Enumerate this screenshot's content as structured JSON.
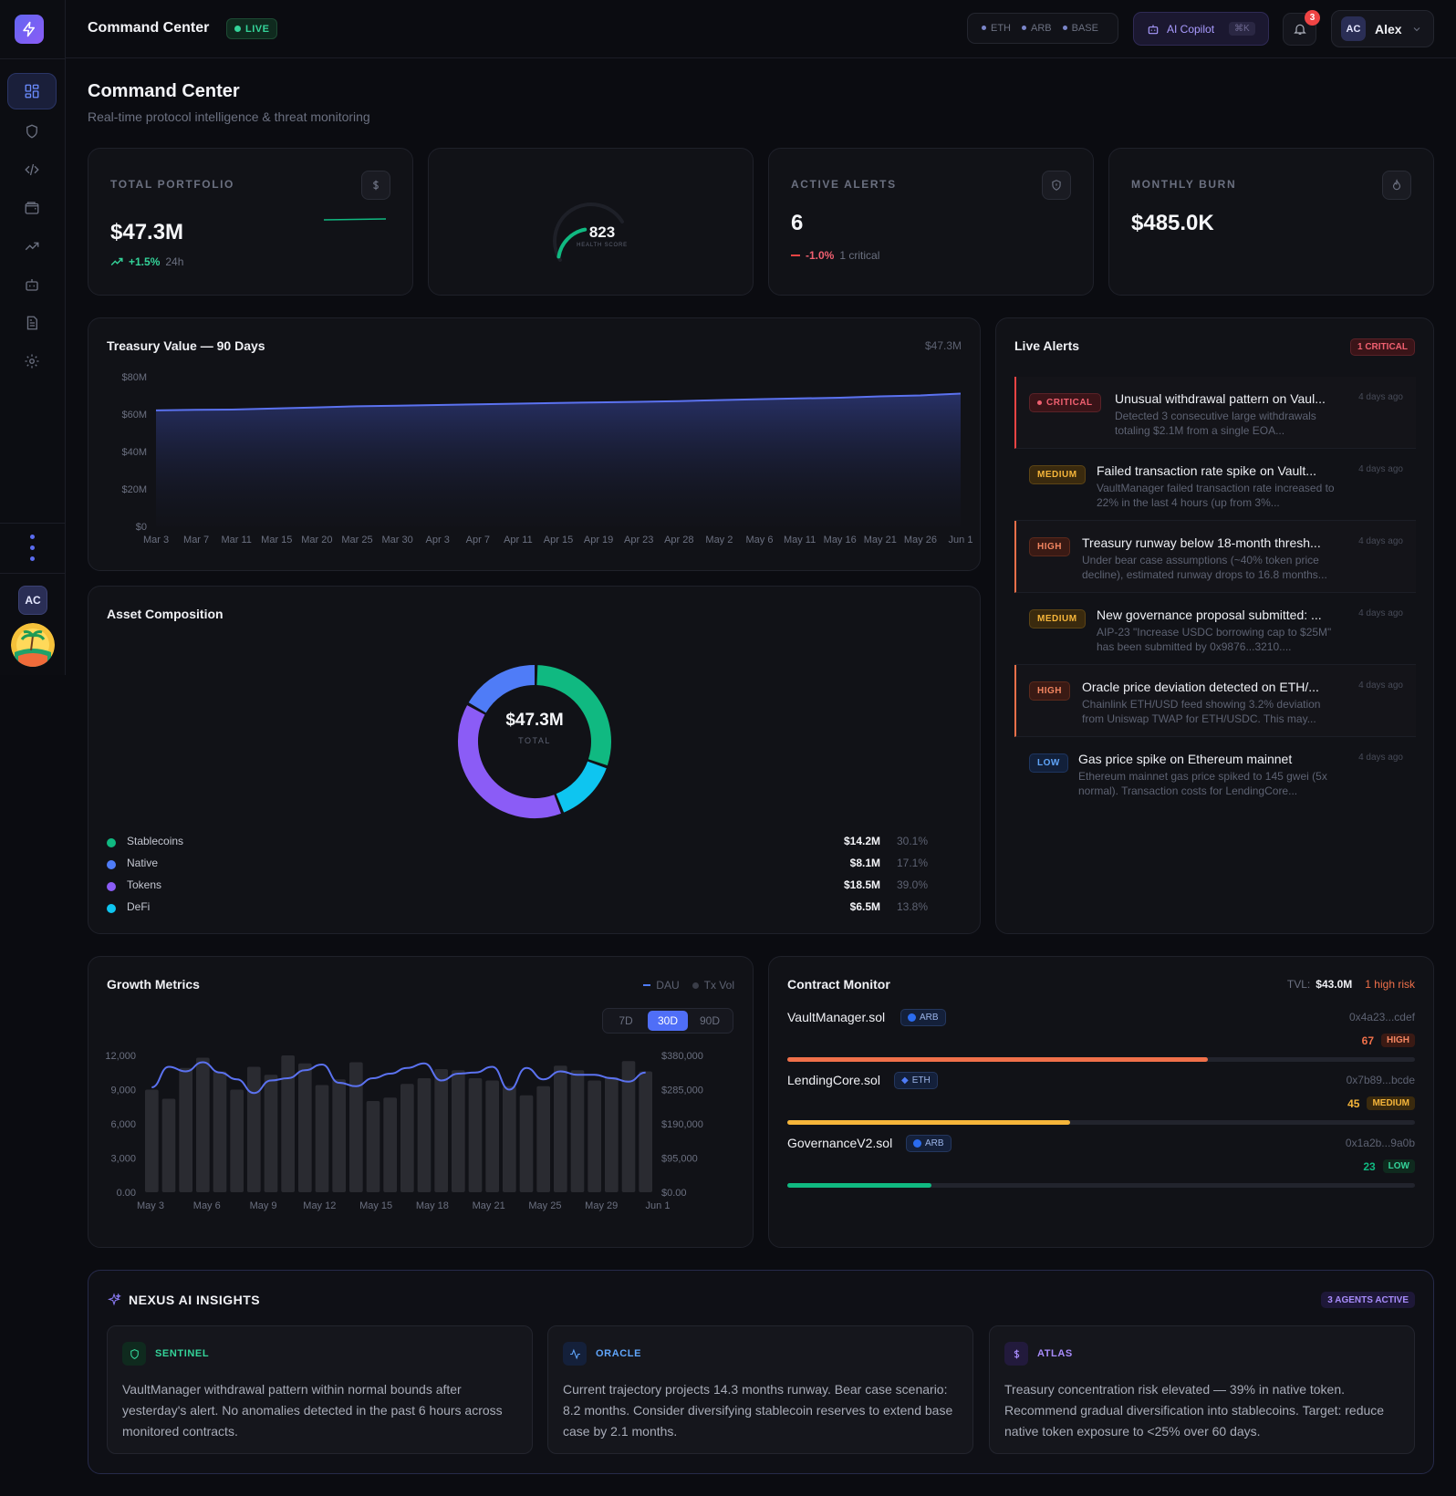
{
  "topbar": {
    "title": "Command Center",
    "live": "LIVE",
    "chains": [
      "ETH",
      "ARB",
      "BASE"
    ],
    "copilot": "AI Copilot",
    "shortcut": "⌘K",
    "notifications": "3",
    "user_initials": "AC",
    "user_name": "Alex"
  },
  "sidebar": {
    "items": [
      "dashboard",
      "security",
      "code",
      "wallet",
      "analytics",
      "agents",
      "reports",
      "settings"
    ],
    "avatar": "AC"
  },
  "page": {
    "title": "Command Center",
    "subtitle": "Real-time protocol intelligence & threat monitoring"
  },
  "kpis": {
    "portfolio": {
      "label": "TOTAL PORTFOLIO",
      "value": "$47.3M",
      "change": "+1.5%",
      "period": "24h"
    },
    "health": {
      "value": "823",
      "label": "HEALTH SCORE",
      "fraction": 0.41
    },
    "alerts": {
      "label": "ACTIVE ALERTS",
      "value": "6",
      "change": "-1.0%",
      "note": "1 critical"
    },
    "burn": {
      "label": "MONTHLY BURN",
      "value": "$485.0K"
    }
  },
  "treasury": {
    "title": "Treasury Value — 90 Days",
    "current": "$47.3M"
  },
  "composition": {
    "title": "Asset Composition",
    "total": "$47.3M",
    "total_label": "TOTAL",
    "items": [
      {
        "name": "Stablecoins",
        "value": "$14.2M",
        "pct": "30.1%",
        "color": "#10b981"
      },
      {
        "name": "Native",
        "value": "$8.1M",
        "pct": "17.1%",
        "color": "#4f7cf7"
      },
      {
        "name": "Tokens",
        "value": "$18.5M",
        "pct": "39.0%",
        "color": "#8b5cf6"
      },
      {
        "name": "DeFi",
        "value": "$6.5M",
        "pct": "13.8%",
        "color": "#0ec5f0"
      }
    ]
  },
  "alerts": {
    "title": "Live Alerts",
    "badge": "1 CRITICAL",
    "items": [
      {
        "severity": "CRITICAL",
        "title": "Unusual withdrawal pattern on Vaul...",
        "desc": "Detected 3 consecutive large withdrawals totaling $2.1M from a single EOA...",
        "time": "4 days ago"
      },
      {
        "severity": "MEDIUM",
        "title": "Failed transaction rate spike on Vault...",
        "desc": "VaultManager failed transaction rate increased to 22% in the last 4 hours (up from 3%...",
        "time": "4 days ago"
      },
      {
        "severity": "HIGH",
        "title": "Treasury runway below 18-month thresh...",
        "desc": "Under bear case assumptions (~40% token price decline), estimated runway drops to 16.8 months...",
        "time": "4 days ago"
      },
      {
        "severity": "MEDIUM",
        "title": "New governance proposal submitted: ...",
        "desc": "AIP-23 \"Increase USDC borrowing cap to $25M\" has been submitted by 0x9876...3210....",
        "time": "4 days ago"
      },
      {
        "severity": "HIGH",
        "title": "Oracle price deviation detected on ETH/...",
        "desc": "Chainlink ETH/USD feed showing 3.2% deviation from Uniswap TWAP for ETH/USDC. This may...",
        "time": "4 days ago"
      },
      {
        "severity": "LOW",
        "title": "Gas price spike on Ethereum mainnet",
        "desc": "Ethereum mainnet gas price spiked to 145 gwei (5x normal). Transaction costs for LendingCore...",
        "time": "4 days ago"
      }
    ]
  },
  "growth": {
    "title": "Growth Metrics",
    "legend": [
      "DAU",
      "Tx Vol"
    ],
    "ranges": [
      "7D",
      "30D",
      "90D"
    ],
    "selected": "30D"
  },
  "contracts": {
    "title": "Contract Monitor",
    "tvl_label": "TVL:",
    "tvl": "$43.0M",
    "risk_note": "1 high risk",
    "items": [
      {
        "name": "VaultManager.sol",
        "chain": "ARB",
        "address": "0x4a23...cdef",
        "score": "67",
        "level": "HIGH",
        "fraction": 0.67,
        "color": "#f0704a"
      },
      {
        "name": "LendingCore.sol",
        "chain": "ETH",
        "address": "0x7b89...bcde",
        "score": "45",
        "level": "MEDIUM",
        "fraction": 0.45,
        "color": "#f5b53a"
      },
      {
        "name": "GovernanceV2.sol",
        "chain": "ARB",
        "address": "0x1a2b...9a0b",
        "score": "23",
        "level": "LOW",
        "fraction": 0.23,
        "color": "#10b981"
      }
    ]
  },
  "insights": {
    "title": "NEXUS AI INSIGHTS",
    "badge": "3 AGENTS ACTIVE",
    "cards": [
      {
        "agent": "SENTINEL",
        "text": "VaultManager withdrawal pattern within normal bounds after yesterday's alert. No anomalies detected in the past 6 hours across monitored contracts.",
        "color": "#34d399"
      },
      {
        "agent": "ORACLE",
        "text": "Current trajectory projects 14.3 months runway. Bear case scenario: 8.2 months. Consider diversifying stablecoin reserves to extend base case by 2.1 months.",
        "color": "#60a5fa"
      },
      {
        "agent": "ATLAS",
        "text": "Treasury concentration risk elevated — 39% in native token. Recommend gradual diversification into stablecoins. Target: reduce native token exposure to <25% over 60 days.",
        "color": "#a78bfa"
      }
    ]
  },
  "chart_data": [
    {
      "type": "area",
      "title": "Treasury Value — 90 Days",
      "x": [
        "Mar 3",
        "Mar 7",
        "Mar 11",
        "Mar 15",
        "Mar 20",
        "Mar 25",
        "Mar 30",
        "Apr 3",
        "Apr 7",
        "Apr 11",
        "Apr 15",
        "Apr 19",
        "Apr 23",
        "Apr 28",
        "May 2",
        "May 6",
        "May 11",
        "May 16",
        "May 21",
        "May 26",
        "Jun 1"
      ],
      "y_ticks": [
        "$0",
        "$20M",
        "$40M",
        "$60M",
        "$80M"
      ],
      "ylim": [
        0,
        80
      ],
      "series": [
        {
          "values": [
            62,
            62.3,
            62.5,
            63,
            63.6,
            64.2,
            64.5,
            64.9,
            65.2,
            65.6,
            66,
            66.3,
            66.6,
            67,
            67.5,
            68,
            68.4,
            68.8,
            69.5,
            70,
            71
          ]
        }
      ]
    },
    {
      "type": "pie",
      "title": "Asset Composition",
      "categories": [
        "Stablecoins",
        "Native",
        "Tokens",
        "DeFi"
      ],
      "values": [
        14.2,
        8.1,
        18.5,
        6.5
      ]
    },
    {
      "type": "bar",
      "title": "Growth Metrics",
      "x": [
        "May 3",
        "May 6",
        "May 9",
        "May 12",
        "May 15",
        "May 18",
        "May 21",
        "May 25",
        "May 29",
        "Jun 1"
      ],
      "y_ticks": [
        "0.00",
        "3,000",
        "6,000",
        "9,000",
        "12,000"
      ],
      "y2_ticks": [
        "$0.00",
        "$95,000",
        "$190,000",
        "$285,000",
        "$380,000"
      ],
      "ylim": [
        0,
        12000
      ],
      "series": [
        {
          "name": "DAU",
          "values": [
            9200,
            11000,
            10600,
            11400,
            10500,
            9900,
            8700,
            9800,
            10000,
            10700,
            11200,
            9600,
            9300,
            10000,
            10400,
            10900,
            11300,
            9800,
            10400,
            10500,
            11000,
            9000,
            10900,
            9900,
            10600,
            10300,
            10300,
            10000,
            9700,
            10500
          ]
        },
        {
          "name": "Tx Vol",
          "values": [
            9000,
            8200,
            10900,
            11800,
            10600,
            9000,
            11000,
            10300,
            12000,
            11300,
            9400,
            9900,
            11400,
            8000,
            8300,
            9500,
            10000,
            10800,
            10700,
            10000,
            9800,
            9300,
            8500,
            9300,
            11100,
            10700,
            9800,
            10100,
            11500,
            10600
          ]
        }
      ]
    }
  ]
}
